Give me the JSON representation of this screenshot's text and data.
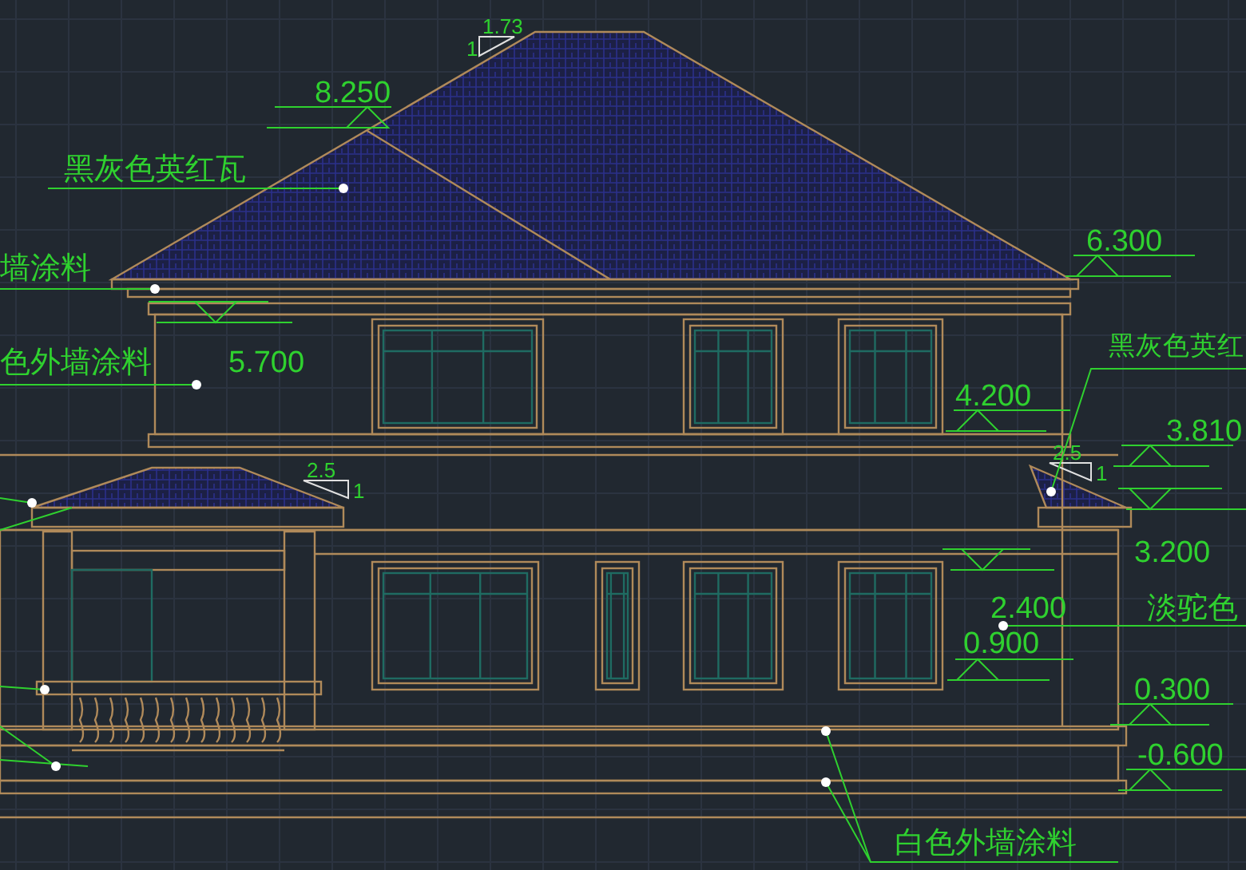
{
  "elevation_marks": [
    "8.250",
    "6.300",
    "5.700",
    "4.200",
    "3.810",
    "3.200",
    "2.400",
    "0.900",
    "0.300",
    "-0.600"
  ],
  "slope_marks": [
    {
      "run": "1.73",
      "rise": "1"
    },
    {
      "run": "2.5",
      "rise": "1"
    },
    {
      "run": "2.5",
      "rise": "1"
    }
  ],
  "annotations": [
    "黑灰色英红瓦",
    "墙涂料",
    "色外墙涂料",
    "黑灰色英红",
    "淡驼色",
    "白色外墙涂料"
  ]
}
